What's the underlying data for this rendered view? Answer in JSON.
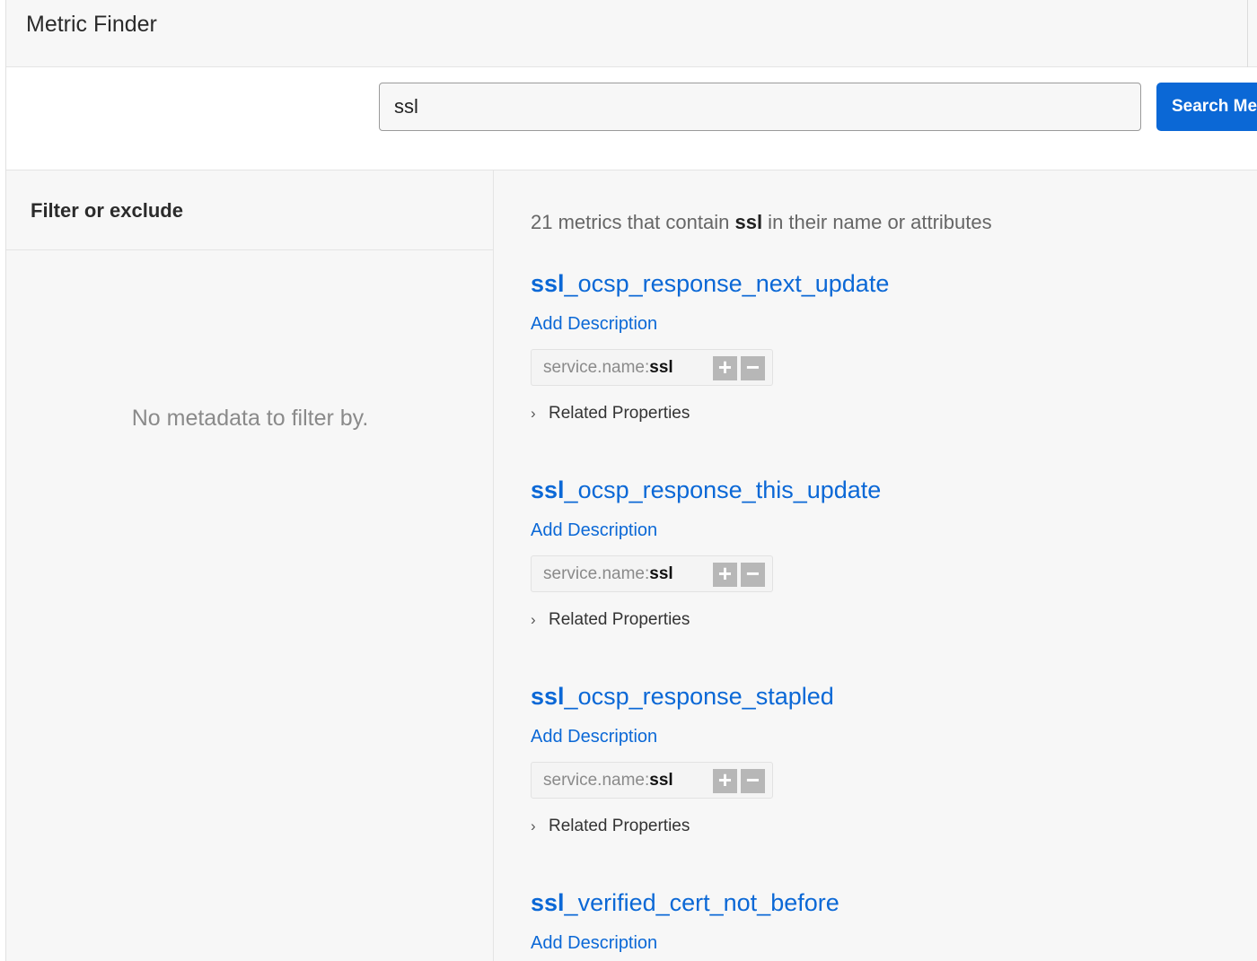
{
  "header": {
    "title": "Metric Finder"
  },
  "search": {
    "value": "ssl",
    "button_label": "Search Me"
  },
  "sidebar": {
    "heading": "Filter or exclude",
    "empty_message": "No metadata to filter by."
  },
  "results": {
    "summary_count": "21",
    "summary_pre": " metrics that contain ",
    "summary_term": "ssl",
    "summary_post": " in their name or attributes",
    "metrics": [
      {
        "name_match": "ssl",
        "name_rest": "_ocsp_response_next_update",
        "add_description": "Add Description",
        "tag_key": "service.name:",
        "tag_value": "ssl",
        "plus": "+",
        "minus": "−",
        "related": "Related Properties"
      },
      {
        "name_match": "ssl",
        "name_rest": "_ocsp_response_this_update",
        "add_description": "Add Description",
        "tag_key": "service.name:",
        "tag_value": "ssl",
        "plus": "+",
        "minus": "−",
        "related": "Related Properties"
      },
      {
        "name_match": "ssl",
        "name_rest": "_ocsp_response_stapled",
        "add_description": "Add Description",
        "tag_key": "service.name:",
        "tag_value": "ssl",
        "plus": "+",
        "minus": "−",
        "related": "Related Properties"
      },
      {
        "name_match": "ssl",
        "name_rest": "_verified_cert_not_before",
        "add_description": "Add Description"
      }
    ]
  },
  "icons": {
    "chevron": "chevron-right-icon"
  },
  "colors": {
    "accent": "#0b68d6",
    "tag_button": "#b7b7b7"
  }
}
